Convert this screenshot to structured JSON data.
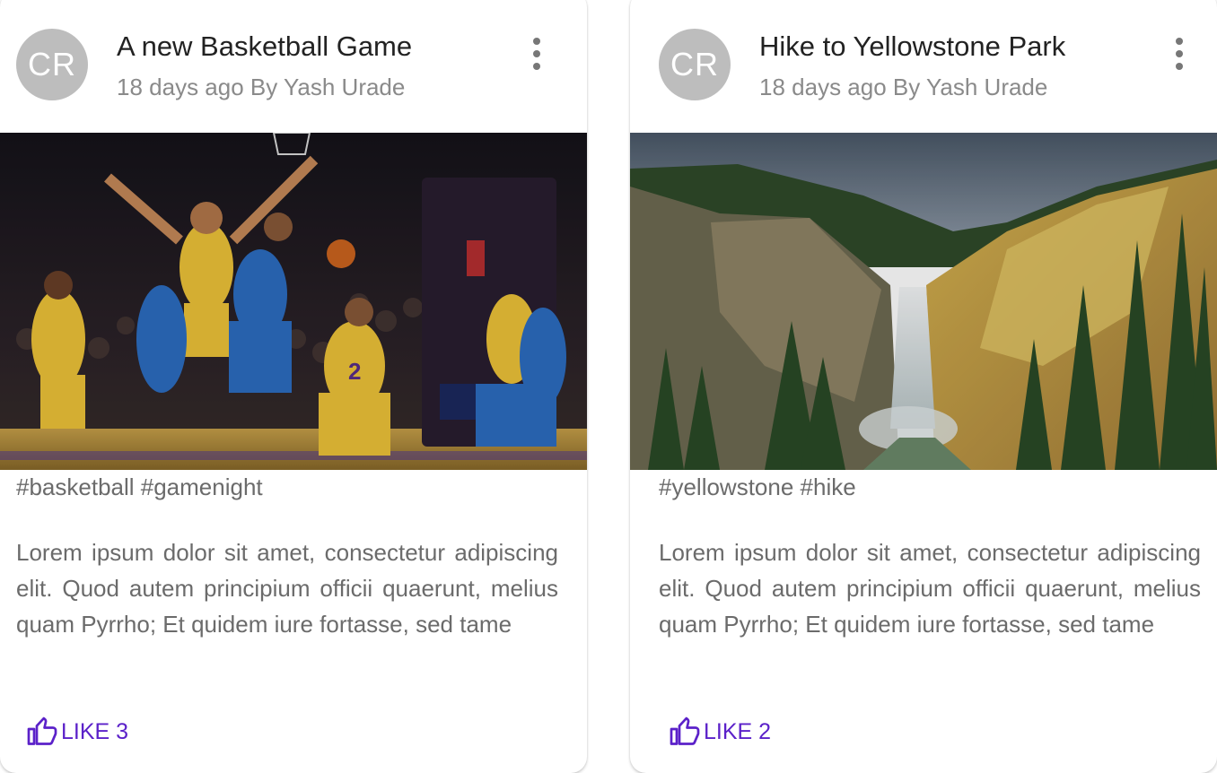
{
  "posts": [
    {
      "avatar_initials": "CR",
      "title": "A new Basketball Game",
      "subheader": "18 days ago By Yash Urade",
      "image_icon": "basketball-game-photo",
      "tags": "#basketball #gamenight",
      "body": "Lorem ipsum dolor sit amet, consectetur adipiscing elit. Quod autem principium officii quaerunt, melius quam Pyrrho; Et quidem iure fortasse, sed tame",
      "like_label": "LIKE 3",
      "like_icon": "thumb-up-icon"
    },
    {
      "avatar_initials": "CR",
      "title": "Hike to Yellowstone Park",
      "subheader": "18 days ago By Yash Urade",
      "image_icon": "yellowstone-waterfall-photo",
      "tags": "#yellowstone #hike",
      "body": "Lorem ipsum dolor sit amet, consectetur adipiscing elit. Quod autem principium officii quaerunt, melius quam Pyrrho; Et quidem iure fortasse, sed tame",
      "like_label": "LIKE 2",
      "like_icon": "thumb-up-icon"
    }
  ],
  "colors": {
    "accent": "#5b21c9",
    "avatar_bg": "#bdbdbd",
    "title": "#222222",
    "secondary_text": "#8a8a8a"
  }
}
